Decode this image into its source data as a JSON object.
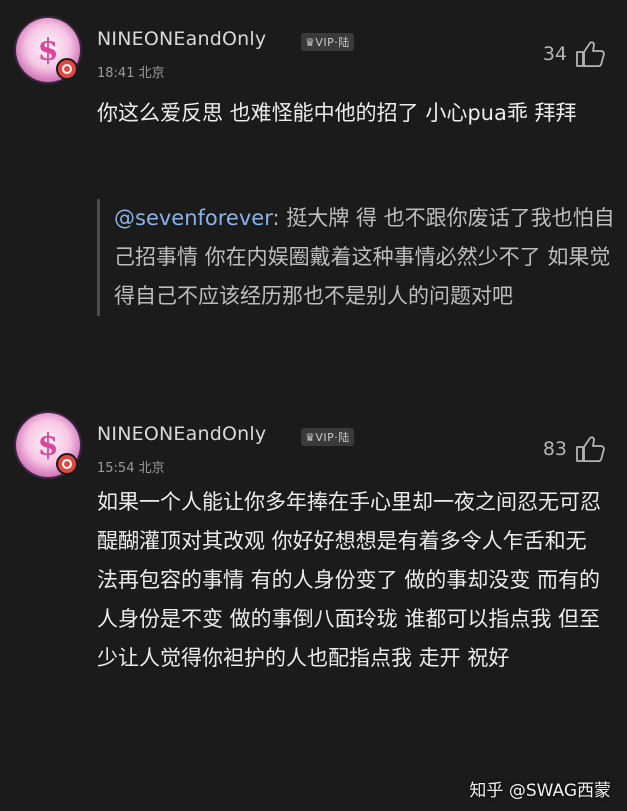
{
  "comments": [
    {
      "username": "NINEONEandOnly",
      "vip_badge": "♛VIP·陆",
      "time": "18:41",
      "location": "北京",
      "likes": "34",
      "text": "你这么爱反思 也难怪能中他的招了 小心pua乖 拜拜",
      "quote": {
        "mention": "@sevenforever",
        "text": ": 挺大牌 得 也不跟你废话了我也怕自己招事情 你在内娱圈戴着这种事情必然少不了 如果觉得自己不应该经历那也不是别人的问题对吧"
      }
    },
    {
      "username": "NINEONEandOnly",
      "vip_badge": "♛VIP·陆",
      "time": "15:54",
      "location": "北京",
      "likes": "83",
      "text": "如果一个人能让你多年捧在手心里却一夜之间忍无可忍醍醐灌顶对其改观 你好好想想是有着多令人乍舌和无法再包容的事情 有的人身份变了 做的事却没变 而有的人身份是不变 做的事倒八面玲珑 谁都可以指点我 但至少让人觉得你袒护的人也配指点我  走开 祝好"
    }
  ],
  "watermark": "知乎 @SWAG西蒙",
  "colors": {
    "background": "#1b1b1b",
    "mention": "#8ab4e8",
    "text": "#ececec",
    "meta": "#9a9a9a"
  },
  "icons": [
    "avatar-glyph",
    "thumbs-up-icon",
    "location-badge-icon"
  ]
}
